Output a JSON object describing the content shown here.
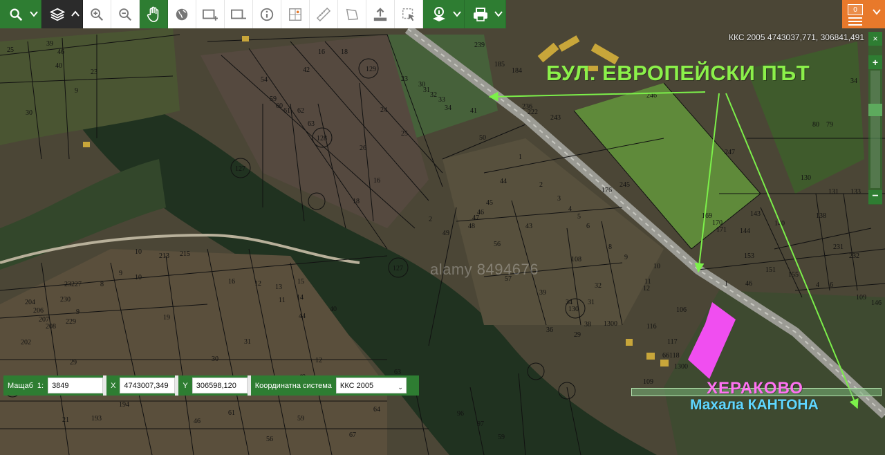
{
  "toolbar": {
    "buttons": [
      {
        "name": "search-button",
        "icon": "search-icon"
      },
      {
        "name": "layers-button",
        "icon": "layers-icon"
      },
      {
        "name": "zoom-in-button",
        "icon": "zoom-in-icon"
      },
      {
        "name": "zoom-out-button",
        "icon": "zoom-out-icon"
      },
      {
        "name": "pan-button",
        "icon": "hand-icon"
      },
      {
        "name": "globe-button",
        "icon": "globe-icon"
      },
      {
        "name": "zoom-box-in-button",
        "icon": "zoom-box-icon"
      },
      {
        "name": "zoom-box-out-button",
        "icon": "zoom-box-out-icon"
      },
      {
        "name": "info-button",
        "icon": "info-icon"
      },
      {
        "name": "coordinate-button",
        "icon": "coordinate-icon"
      },
      {
        "name": "measure-distance-button",
        "icon": "ruler-icon"
      },
      {
        "name": "measure-area-button",
        "icon": "polygon-icon"
      },
      {
        "name": "upload-button",
        "icon": "upload-icon"
      },
      {
        "name": "select-button",
        "icon": "select-icon"
      },
      {
        "name": "identify-layer-button",
        "icon": "identify-icon"
      },
      {
        "name": "print-button",
        "icon": "print-icon"
      }
    ],
    "cart_count": "0"
  },
  "map": {
    "coordinate_readout": "ККС 2005 4743037,771, 306841,491",
    "watermark": "alamy 8494676",
    "annotation_road": "БУЛ. ЕВРОПЕЙСКИ ПЪТ",
    "annotation_village": "ХЕРАКОВО",
    "annotation_hamlet": "Махала КАНТОНА",
    "colors": {
      "arrow": "#7cf04a",
      "highlight_parcel": "#f04ef0",
      "parcel_line": "#111111",
      "toolbar_green": "#2e7d32",
      "toolbar_orange": "#e8792b"
    }
  },
  "coordbar": {
    "scale_label": "Мащаб",
    "scale_prefix": "1:",
    "scale_value": "3849",
    "x_label": "X",
    "x_value": "4743007,349",
    "y_label": "Y",
    "y_value": "306598,120",
    "crs_label": "Координатна система",
    "crs_value": "ККС 2005"
  },
  "zoom": {
    "close": "×",
    "plus": "+",
    "minus": "−"
  }
}
